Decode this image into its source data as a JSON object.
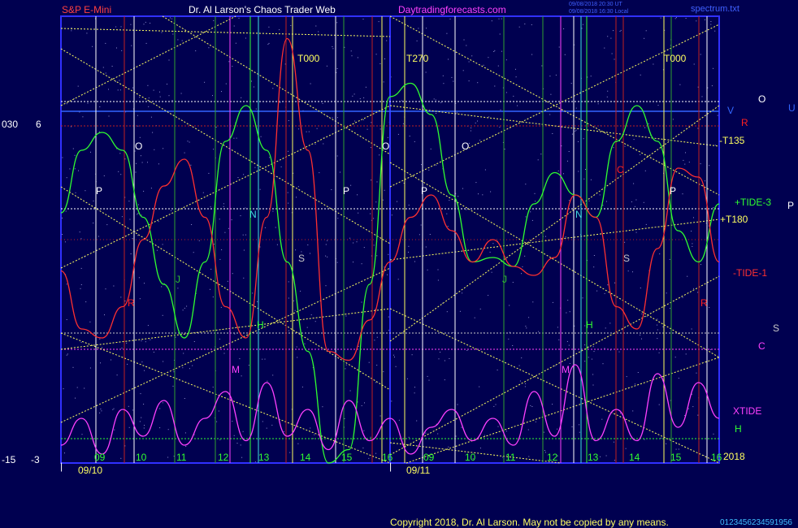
{
  "header": {
    "instrument": "S&P E-Mini",
    "title": "Dr. Al Larson's Chaos Trader Web",
    "site": "Daytradingforecasts.com",
    "stamp_line1": "09/08/2018 20:30 UT",
    "stamp_line2": "09/08/2018 16:30 Local",
    "file": "spectrum.txt"
  },
  "footer": {
    "copyright": "Copyright 2018, Dr. Al Larson. May not be copied by any means.",
    "scale_digits": "0123456234591956"
  },
  "left_scale": {
    "top_a": "030",
    "top_b": "6",
    "bottom_a": "-15",
    "bottom_b": "-3"
  },
  "x_axis": {
    "days": [
      "09/10",
      "09/11"
    ],
    "hours": [
      "09",
      "10",
      "11",
      "12",
      "13",
      "14",
      "15",
      "16",
      "09",
      "10",
      "11",
      "12",
      "13",
      "14",
      "15",
      "16"
    ]
  },
  "right_labels": [
    {
      "text": "O",
      "color": "#ffffff"
    },
    {
      "text": "U",
      "color": "#3366ff"
    },
    {
      "text": "V",
      "color": "#3366ff"
    },
    {
      "text": "R",
      "color": "#ff2020"
    },
    {
      "text": "-T135",
      "color": "#ffff60"
    },
    {
      "text": "+TIDE-3",
      "color": "#30ff30"
    },
    {
      "text": "P",
      "color": "#ffffff"
    },
    {
      "text": "+T180",
      "color": "#ffff60"
    },
    {
      "text": "-TIDE-1",
      "color": "#ff3030"
    },
    {
      "text": "S",
      "color": "#c8c8c8"
    },
    {
      "text": "C",
      "color": "#ff40ff"
    },
    {
      "text": "XTIDE",
      "color": "#ff40ff"
    },
    {
      "text": "H",
      "color": "#30ff30"
    },
    {
      "text": "2018",
      "color": "#ffff60"
    }
  ],
  "planet_labels": [
    {
      "text": "O",
      "color": "#ffffff"
    },
    {
      "text": "P",
      "color": "#ffffff"
    },
    {
      "text": "J",
      "color": "#30c030"
    },
    {
      "text": "M",
      "color": "#ff40ff"
    },
    {
      "text": "N",
      "color": "#40e0e0"
    },
    {
      "text": "H",
      "color": "#30ff30"
    },
    {
      "text": "S",
      "color": "#c8c8c8"
    },
    {
      "text": "P",
      "color": "#ffffff"
    },
    {
      "text": "O",
      "color": "#ffffff"
    },
    {
      "text": "P",
      "color": "#ffffff"
    },
    {
      "text": "O",
      "color": "#ffffff"
    },
    {
      "text": "J",
      "color": "#30c030"
    },
    {
      "text": "N",
      "color": "#40e0e0"
    },
    {
      "text": "H",
      "color": "#30ff30"
    },
    {
      "text": "M",
      "color": "#ff40ff"
    },
    {
      "text": "S",
      "color": "#c8c8c8"
    },
    {
      "text": "C",
      "color": "#ff2020"
    },
    {
      "text": "P",
      "color": "#ffffff"
    },
    {
      "text": "R",
      "color": "#ff2020"
    },
    {
      "text": "R",
      "color": "#ff2020"
    }
  ],
  "markers": [
    "T000",
    "T270",
    "T000"
  ],
  "chart_data": {
    "type": "line",
    "series": [
      {
        "name": "+TIDE-3",
        "color": "#30ff30",
        "values": [
          0.56,
          0.7,
          0.74,
          0.7,
          0.55,
          0.4,
          0.28,
          0.45,
          0.72,
          0.8,
          0.7,
          0.45,
          0.25,
          0.0,
          0.03,
          0.4,
          0.82,
          0.85,
          0.78,
          0.6,
          0.45,
          0.46,
          0.44,
          0.58,
          0.65,
          0.6,
          0.55,
          0.72,
          0.8,
          0.72,
          0.52,
          0.45,
          0.58
        ]
      },
      {
        "name": "-TIDE-1",
        "color": "#ff3030",
        "values": [
          0.43,
          0.3,
          0.28,
          0.35,
          0.5,
          0.62,
          0.68,
          0.55,
          0.35,
          0.28,
          0.55,
          0.95,
          0.7,
          0.25,
          0.23,
          0.32,
          0.45,
          0.55,
          0.6,
          0.52,
          0.45,
          0.5,
          0.44,
          0.42,
          0.46,
          0.6,
          0.55,
          0.35,
          0.3,
          0.48,
          0.66,
          0.64,
          0.45
        ]
      },
      {
        "name": "XTIDE",
        "color": "#ff40ff",
        "values": [
          0.04,
          0.1,
          0.02,
          0.12,
          0.06,
          0.14,
          0.04,
          0.1,
          0.16,
          0.05,
          0.18,
          0.06,
          0.12,
          0.03,
          0.14,
          0.05,
          0.1,
          0.02,
          0.08,
          0.12,
          0.05,
          0.1,
          0.04,
          0.16,
          0.06,
          0.22,
          0.05,
          0.12,
          0.05,
          0.2,
          0.08,
          0.18,
          0.1
        ]
      }
    ]
  }
}
